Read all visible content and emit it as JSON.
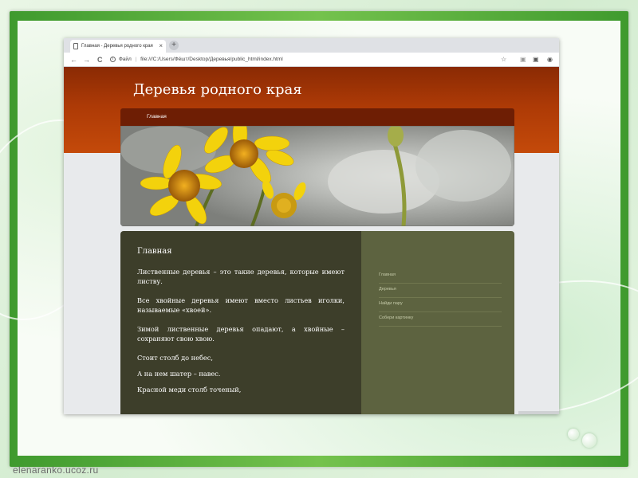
{
  "slide": {
    "watermark": "elenaranko.ucoz.ru",
    "frame_color": "#4caa36"
  },
  "browser": {
    "tab_title": "Главная - Деревья родного края",
    "tab_close_icon": "×",
    "new_tab_icon": "+",
    "back_icon": "←",
    "forward_icon": "→",
    "reload_icon": "C",
    "info_icon": "i",
    "scheme_label": "Файл",
    "url": "file:///C:/Users/Фёшт/Desktop/Деревья/public_html/index.html",
    "bookmark_icon": "☆",
    "extension_icon": "▣",
    "account_icon": "◉"
  },
  "site": {
    "title": "Деревья родного края",
    "nav": [
      {
        "label": "Главная"
      }
    ],
    "header_color": "#b03c06",
    "main": {
      "heading": "Главная",
      "paragraphs": [
        "Лиственные деревья – это такие деревья, которые имеют листву.",
        "Все хвойные деревья имеют вместо листьев иголки, называемые «хвоей».",
        "Зимой лиственные деревья опадают, а хвойные – сохраняют свою хвою."
      ],
      "poem": [
        "Стоит столб до небес,",
        "А на нем шатер – навес.",
        "Красной меди столб точеный,"
      ]
    },
    "sidebar": [
      {
        "label": "Главная"
      },
      {
        "label": "Деревья"
      },
      {
        "label": "Найди пару"
      },
      {
        "label": "Собери картинку"
      }
    ]
  }
}
